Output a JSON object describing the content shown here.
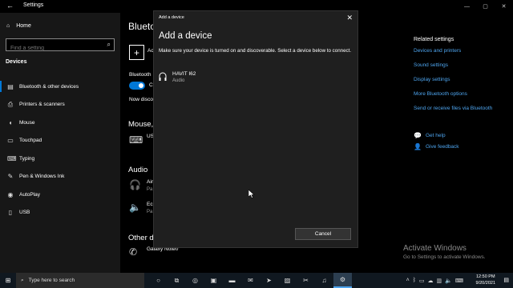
{
  "window": {
    "title": "Settings",
    "controls": [
      "—",
      "▢",
      "✕"
    ]
  },
  "nav": {
    "home": "Home",
    "search_placeholder": "Find a setting",
    "section": "Devices",
    "items": [
      {
        "label": "Bluetooth & other devices",
        "icon": "bluetooth-icon"
      },
      {
        "label": "Printers & scanners",
        "icon": "printer-icon"
      },
      {
        "label": "Mouse",
        "icon": "mouse-icon"
      },
      {
        "label": "Touchpad",
        "icon": "touchpad-icon"
      },
      {
        "label": "Typing",
        "icon": "keyboard-icon"
      },
      {
        "label": "Pen & Windows Ink",
        "icon": "pen-icon"
      },
      {
        "label": "AutoPlay",
        "icon": "autoplay-icon"
      },
      {
        "label": "USB",
        "icon": "usb-icon"
      }
    ]
  },
  "main": {
    "title": "Blueto",
    "add_text": "Ac",
    "bt_label": "Bluetooth",
    "toggle_text": "C",
    "now_discoverable": "Now disco",
    "mouse_heading": "Mouse,",
    "mouse_device": "US",
    "audio_heading": "Audio",
    "audio_devices": [
      {
        "name": "Air",
        "sub": "Pa"
      },
      {
        "name": "Ech",
        "sub": "Pa"
      }
    ],
    "other_heading": "Other d",
    "other_device": "Galaxy Note0"
  },
  "related": {
    "heading": "Related settings",
    "links": [
      "Devices and printers",
      "Sound settings",
      "Display settings",
      "More Bluetooth options",
      "Send or receive files via Bluetooth"
    ],
    "get_help": "Get help",
    "give_feedback": "Give feedback"
  },
  "dialog": {
    "caption": "Add a device",
    "title": "Add a device",
    "description": "Make sure your device is turned on and discoverable. Select a device below to connect.",
    "device_name": "HAVIT I62",
    "device_type": "Audio",
    "cancel": "Cancel"
  },
  "watermark": {
    "line1": "Activate Windows",
    "line2": "Go to Settings to activate Windows."
  },
  "taskbar": {
    "search_placeholder": "Type here to search",
    "time": "12:50 PM",
    "date": "9/20/2021",
    "accent": "#4ea5ef"
  }
}
